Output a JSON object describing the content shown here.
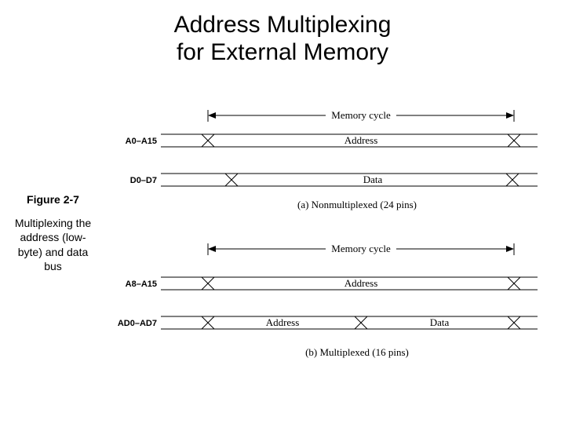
{
  "title_line1": "Address Multiplexing",
  "title_line2": "for External Memory",
  "figure_number": "Figure 2-7",
  "caption": "Multiplexing the address (low-byte) and data bus",
  "top": {
    "cycle_label": "Memory cycle",
    "rows": [
      {
        "name": "A0–A15",
        "segs": [
          "Address"
        ]
      },
      {
        "name": "D0–D7",
        "segs": [
          "Data"
        ]
      }
    ],
    "subcaption": "(a) Nonmultiplexed (24 pins)"
  },
  "bottom": {
    "cycle_label": "Memory cycle",
    "rows": [
      {
        "name": "A8–A15",
        "segs": [
          "Address"
        ]
      },
      {
        "name": "AD0–AD7",
        "segs": [
          "Address",
          "Data"
        ]
      }
    ],
    "subcaption": "(b) Multiplexed (16 pins)"
  }
}
